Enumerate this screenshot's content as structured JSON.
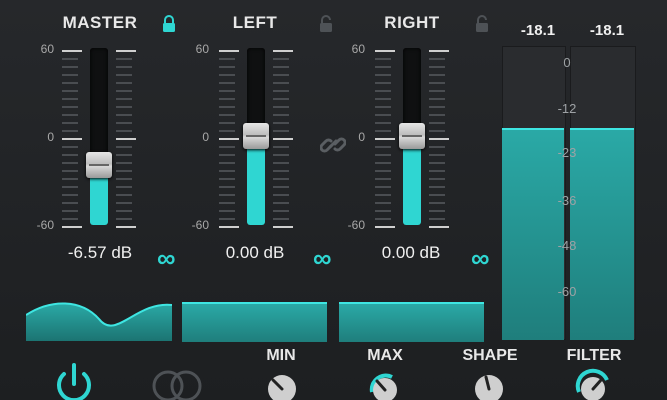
{
  "channels": [
    {
      "name": "MASTER",
      "value": "-6.57 dB",
      "lock": "lock-closed",
      "level_fraction": 0.32
    },
    {
      "name": "LEFT",
      "value": "0.00 dB",
      "lock": "lock-open",
      "level_fraction": 0.5
    },
    {
      "name": "RIGHT",
      "value": "0.00 dB",
      "lock": "lock-open",
      "level_fraction": 0.5
    }
  ],
  "scale": {
    "top": "60",
    "mid": "0",
    "bottom": "-60"
  },
  "link_icon": "link-icon",
  "infinity_symbol": "∞",
  "meters": {
    "peaks": [
      "-18.1",
      "-18.1"
    ],
    "labels": [
      "0",
      "-12",
      "-23",
      "-36",
      "-48",
      "-60"
    ]
  },
  "knobs": {
    "min": "MIN",
    "max": "MAX",
    "shape": "SHAPE",
    "filter": "FILTER"
  },
  "colors": {
    "accent": "#2fd6d2",
    "background": "#222426",
    "text": "#e8e8e8"
  }
}
